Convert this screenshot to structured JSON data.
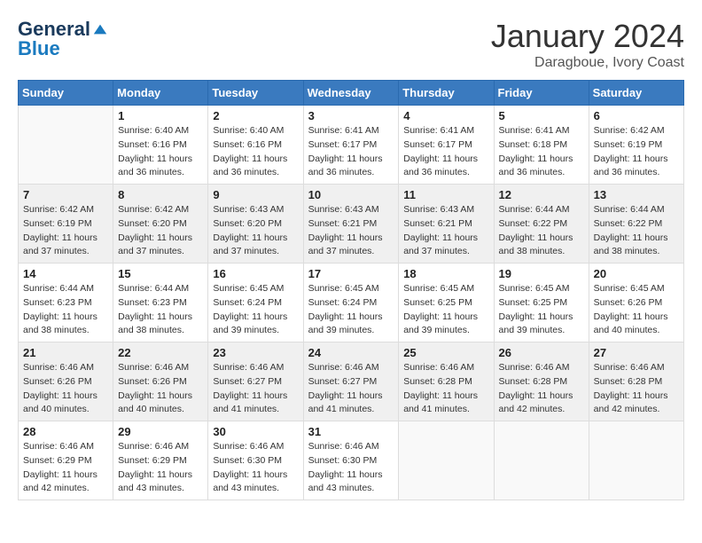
{
  "header": {
    "logo": {
      "general": "General",
      "blue": "Blue"
    },
    "title": "January 2024",
    "location": "Daragboue, Ivory Coast"
  },
  "days_of_week": [
    "Sunday",
    "Monday",
    "Tuesday",
    "Wednesday",
    "Thursday",
    "Friday",
    "Saturday"
  ],
  "weeks": [
    {
      "shaded": false,
      "cells": [
        {
          "day": "",
          "content": ""
        },
        {
          "day": "1",
          "content": "Sunrise: 6:40 AM\nSunset: 6:16 PM\nDaylight: 11 hours and 36 minutes."
        },
        {
          "day": "2",
          "content": "Sunrise: 6:40 AM\nSunset: 6:16 PM\nDaylight: 11 hours and 36 minutes."
        },
        {
          "day": "3",
          "content": "Sunrise: 6:41 AM\nSunset: 6:17 PM\nDaylight: 11 hours and 36 minutes."
        },
        {
          "day": "4",
          "content": "Sunrise: 6:41 AM\nSunset: 6:17 PM\nDaylight: 11 hours and 36 minutes."
        },
        {
          "day": "5",
          "content": "Sunrise: 6:41 AM\nSunset: 6:18 PM\nDaylight: 11 hours and 36 minutes."
        },
        {
          "day": "6",
          "content": "Sunrise: 6:42 AM\nSunset: 6:19 PM\nDaylight: 11 hours and 36 minutes."
        }
      ]
    },
    {
      "shaded": true,
      "cells": [
        {
          "day": "7",
          "content": "Sunrise: 6:42 AM\nSunset: 6:19 PM\nDaylight: 11 hours and 37 minutes."
        },
        {
          "day": "8",
          "content": "Sunrise: 6:42 AM\nSunset: 6:20 PM\nDaylight: 11 hours and 37 minutes."
        },
        {
          "day": "9",
          "content": "Sunrise: 6:43 AM\nSunset: 6:20 PM\nDaylight: 11 hours and 37 minutes."
        },
        {
          "day": "10",
          "content": "Sunrise: 6:43 AM\nSunset: 6:21 PM\nDaylight: 11 hours and 37 minutes."
        },
        {
          "day": "11",
          "content": "Sunrise: 6:43 AM\nSunset: 6:21 PM\nDaylight: 11 hours and 37 minutes."
        },
        {
          "day": "12",
          "content": "Sunrise: 6:44 AM\nSunset: 6:22 PM\nDaylight: 11 hours and 38 minutes."
        },
        {
          "day": "13",
          "content": "Sunrise: 6:44 AM\nSunset: 6:22 PM\nDaylight: 11 hours and 38 minutes."
        }
      ]
    },
    {
      "shaded": false,
      "cells": [
        {
          "day": "14",
          "content": "Sunrise: 6:44 AM\nSunset: 6:23 PM\nDaylight: 11 hours and 38 minutes."
        },
        {
          "day": "15",
          "content": "Sunrise: 6:44 AM\nSunset: 6:23 PM\nDaylight: 11 hours and 38 minutes."
        },
        {
          "day": "16",
          "content": "Sunrise: 6:45 AM\nSunset: 6:24 PM\nDaylight: 11 hours and 39 minutes."
        },
        {
          "day": "17",
          "content": "Sunrise: 6:45 AM\nSunset: 6:24 PM\nDaylight: 11 hours and 39 minutes."
        },
        {
          "day": "18",
          "content": "Sunrise: 6:45 AM\nSunset: 6:25 PM\nDaylight: 11 hours and 39 minutes."
        },
        {
          "day": "19",
          "content": "Sunrise: 6:45 AM\nSunset: 6:25 PM\nDaylight: 11 hours and 39 minutes."
        },
        {
          "day": "20",
          "content": "Sunrise: 6:45 AM\nSunset: 6:26 PM\nDaylight: 11 hours and 40 minutes."
        }
      ]
    },
    {
      "shaded": true,
      "cells": [
        {
          "day": "21",
          "content": "Sunrise: 6:46 AM\nSunset: 6:26 PM\nDaylight: 11 hours and 40 minutes."
        },
        {
          "day": "22",
          "content": "Sunrise: 6:46 AM\nSunset: 6:26 PM\nDaylight: 11 hours and 40 minutes."
        },
        {
          "day": "23",
          "content": "Sunrise: 6:46 AM\nSunset: 6:27 PM\nDaylight: 11 hours and 41 minutes."
        },
        {
          "day": "24",
          "content": "Sunrise: 6:46 AM\nSunset: 6:27 PM\nDaylight: 11 hours and 41 minutes."
        },
        {
          "day": "25",
          "content": "Sunrise: 6:46 AM\nSunset: 6:28 PM\nDaylight: 11 hours and 41 minutes."
        },
        {
          "day": "26",
          "content": "Sunrise: 6:46 AM\nSunset: 6:28 PM\nDaylight: 11 hours and 42 minutes."
        },
        {
          "day": "27",
          "content": "Sunrise: 6:46 AM\nSunset: 6:28 PM\nDaylight: 11 hours and 42 minutes."
        }
      ]
    },
    {
      "shaded": false,
      "cells": [
        {
          "day": "28",
          "content": "Sunrise: 6:46 AM\nSunset: 6:29 PM\nDaylight: 11 hours and 42 minutes."
        },
        {
          "day": "29",
          "content": "Sunrise: 6:46 AM\nSunset: 6:29 PM\nDaylight: 11 hours and 43 minutes."
        },
        {
          "day": "30",
          "content": "Sunrise: 6:46 AM\nSunset: 6:30 PM\nDaylight: 11 hours and 43 minutes."
        },
        {
          "day": "31",
          "content": "Sunrise: 6:46 AM\nSunset: 6:30 PM\nDaylight: 11 hours and 43 minutes."
        },
        {
          "day": "",
          "content": ""
        },
        {
          "day": "",
          "content": ""
        },
        {
          "day": "",
          "content": ""
        }
      ]
    }
  ]
}
